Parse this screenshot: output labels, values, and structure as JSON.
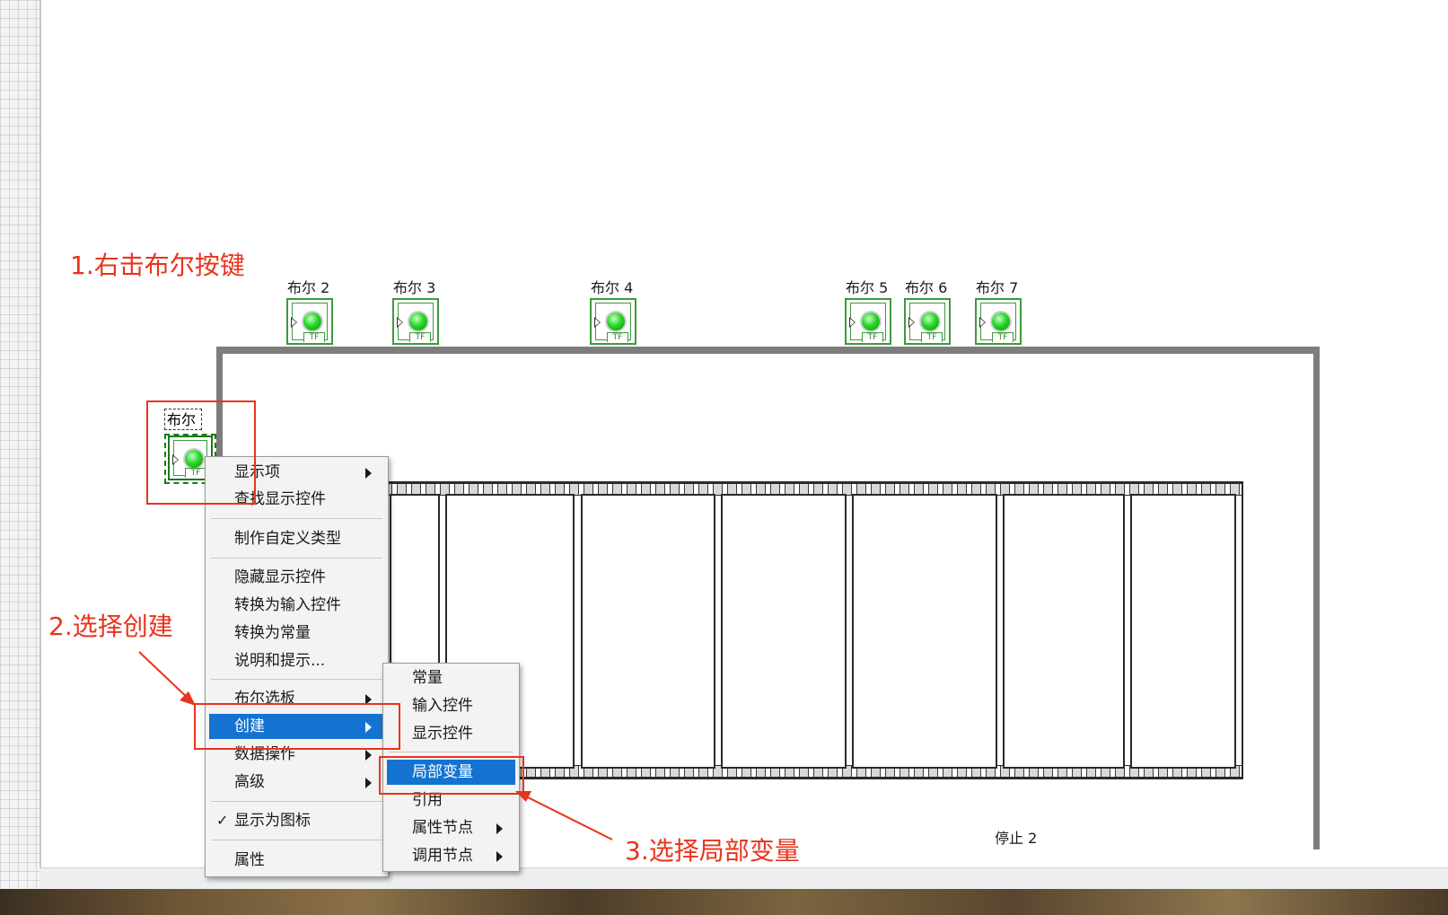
{
  "annotations": {
    "step1": "1.右击布尔按键",
    "step2": "2.选择创建",
    "step3": "3.选择局部变量"
  },
  "booleans": {
    "b2": "布尔 2",
    "b3": "布尔 3",
    "b4": "布尔 4",
    "b5": "布尔 5",
    "b6": "布尔 6",
    "b7": "布尔 7",
    "selected": "布尔",
    "tf_text": "TF"
  },
  "stop_label": "停止 2",
  "context_menu": {
    "items": [
      {
        "label": "显示项",
        "submenu": true
      },
      {
        "label": "查找显示控件"
      },
      {
        "label": "制作自定义类型"
      },
      {
        "label": "隐藏显示控件"
      },
      {
        "label": "转换为输入控件"
      },
      {
        "label": "转换为常量"
      },
      {
        "label": "说明和提示..."
      },
      {
        "label": "布尔选板",
        "submenu": true
      },
      {
        "label": "创建",
        "submenu": true,
        "highlighted": true
      },
      {
        "label": "数据操作",
        "submenu": true
      },
      {
        "label": "高级",
        "submenu": true
      },
      {
        "label": "显示为图标",
        "checked": true
      },
      {
        "label": "属性"
      }
    ],
    "check_mark": "✓"
  },
  "submenu": {
    "items": [
      {
        "label": "常量"
      },
      {
        "label": "输入控件"
      },
      {
        "label": "显示控件"
      },
      {
        "label": "局部变量",
        "highlighted": true
      },
      {
        "label": "引用"
      },
      {
        "label": "属性节点",
        "submenu": true
      },
      {
        "label": "调用节点",
        "submenu": true
      }
    ]
  },
  "colors": {
    "annotation": "#e8341c",
    "highlight": "#1473d1",
    "terminal_green": "#3c9a3c",
    "wire_gray": "#7d7d7d"
  }
}
